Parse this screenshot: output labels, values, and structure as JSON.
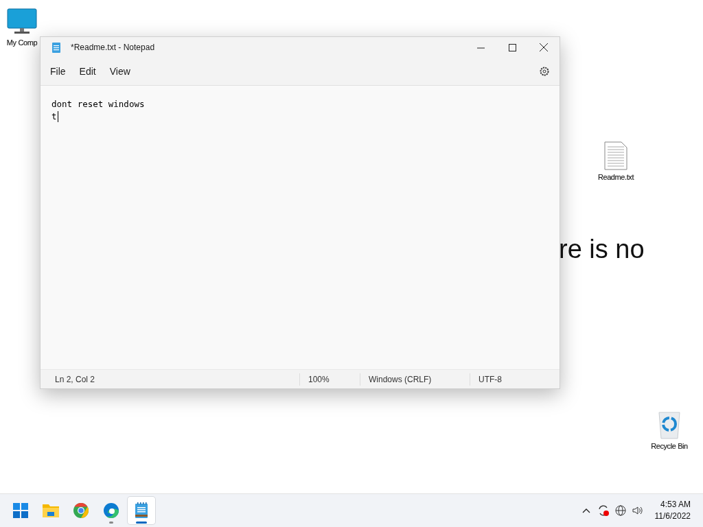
{
  "desktop": {
    "background_text": "re is no",
    "icons": [
      {
        "kind": "computer",
        "label": "My Comp"
      },
      {
        "kind": "textfile",
        "label": "Readme.txt"
      },
      {
        "kind": "recycle",
        "label": "Recycle Bin"
      }
    ]
  },
  "window": {
    "title": "*Readme.txt - Notepad",
    "menu": [
      "File",
      "Edit",
      "View"
    ],
    "lines": [
      "dont reset windows",
      "t"
    ],
    "status_bar": [
      "Ln 2, Col 2",
      "100%",
      "Windows (CRLF)",
      "UTF-8"
    ]
  },
  "taskbar": {
    "apps": [
      {
        "kind": "start",
        "open": false,
        "active": false
      },
      {
        "kind": "explorer",
        "open": false,
        "active": false
      },
      {
        "kind": "chrome",
        "open": false,
        "active": false
      },
      {
        "kind": "edge",
        "open": true,
        "active": false
      },
      {
        "kind": "notepad",
        "open": true,
        "active": true
      }
    ],
    "time": "4:53 AM",
    "date": "11/6/2022"
  }
}
